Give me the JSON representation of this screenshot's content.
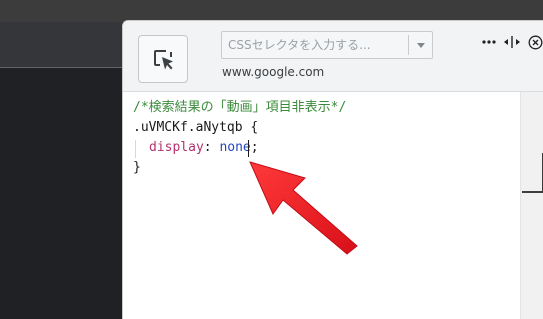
{
  "panel": {
    "selector": {
      "placeholder": "CSSセレクタを入力する...",
      "value": ""
    },
    "domain": "www.google.com",
    "icons": [
      "element-picker-icon",
      "dropdown-arrow-icon",
      "more-options-icon",
      "resize-horizontal-icon",
      "close-icon"
    ]
  },
  "code": {
    "comment": "/*検索結果の「動画」項目非表示*/",
    "selector": ".uVMCKf.aNytqb {",
    "property": "display",
    "colon": ":",
    "value": "none",
    "semicolon": ";",
    "close": "}"
  },
  "colors": {
    "comment": "#3b8b3b",
    "property": "#b5316e",
    "value": "#2848b8",
    "arrow": "#e8141c"
  }
}
